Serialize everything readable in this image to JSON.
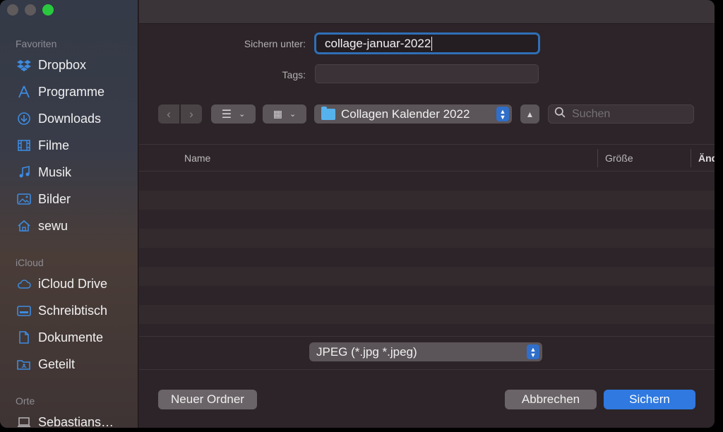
{
  "sidebar": {
    "sections": [
      {
        "title": "Favoriten",
        "items": [
          {
            "label": "Dropbox",
            "icon": "dropbox-icon"
          },
          {
            "label": "Programme",
            "icon": "applications-icon"
          },
          {
            "label": "Downloads",
            "icon": "downloads-icon"
          },
          {
            "label": "Filme",
            "icon": "film-icon"
          },
          {
            "label": "Musik",
            "icon": "music-icon"
          },
          {
            "label": "Bilder",
            "icon": "photos-icon"
          },
          {
            "label": "sewu",
            "icon": "home-icon"
          }
        ]
      },
      {
        "title": "iCloud",
        "items": [
          {
            "label": "iCloud Drive",
            "icon": "cloud-icon"
          },
          {
            "label": "Schreibtisch",
            "icon": "desktop-icon"
          },
          {
            "label": "Dokumente",
            "icon": "document-icon"
          },
          {
            "label": "Geteilt",
            "icon": "shared-folder-icon"
          }
        ]
      },
      {
        "title": "Orte",
        "items": [
          {
            "label": "Sebastians…",
            "icon": "laptop-icon"
          }
        ]
      }
    ]
  },
  "form": {
    "save_as_label": "Sichern unter:",
    "save_as_value": "collage-januar-2022",
    "tags_label": "Tags:"
  },
  "toolbar": {
    "location": "Collagen Kalender 2022",
    "search_placeholder": "Suchen"
  },
  "table": {
    "columns": [
      "Name",
      "Größe",
      "Änd"
    ]
  },
  "format": {
    "selected": "JPEG (*.jpg *.jpeg)"
  },
  "buttons": {
    "new_folder": "Neuer Ordner",
    "cancel": "Abbrechen",
    "save": "Sichern"
  },
  "colors": {
    "accent": "#2f79e0",
    "folder": "#56b2ec",
    "zoom": "#2ac83f"
  }
}
